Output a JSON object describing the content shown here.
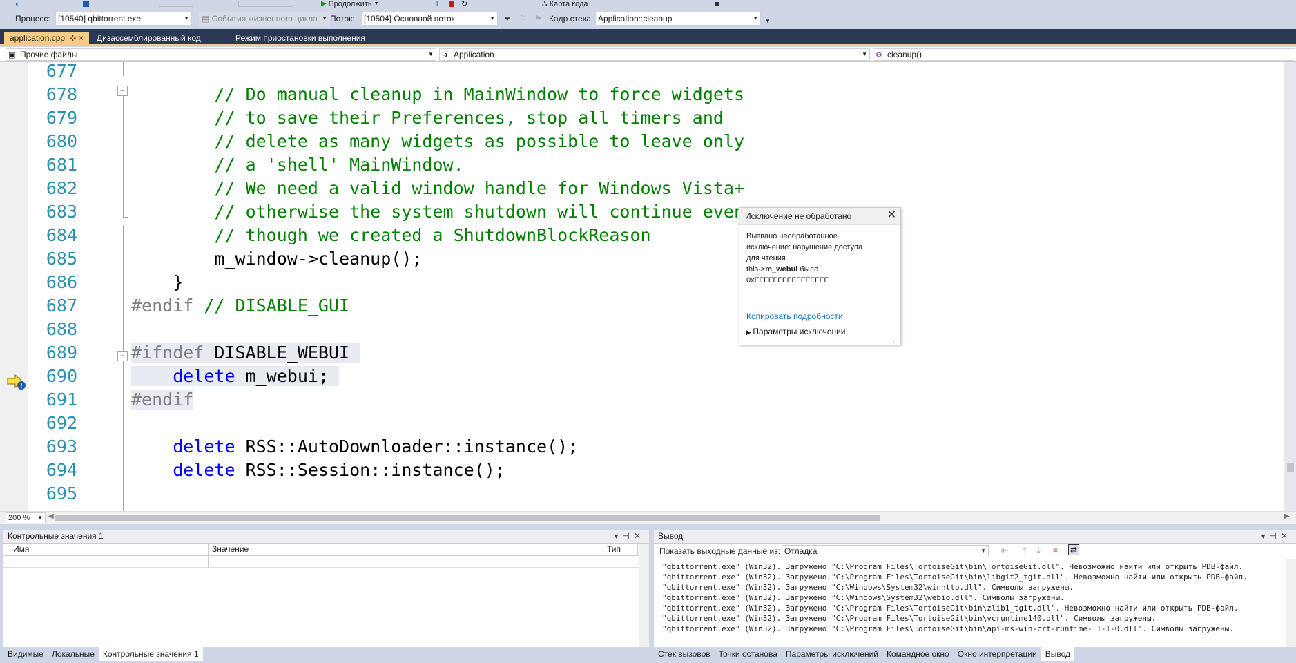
{
  "toolbar_top": {
    "continue_label": "Продолжить",
    "codemap_label": "Карта кода"
  },
  "debug_location": {
    "process_label": "Процесс:",
    "process_value": "[10540] qbittorrent.exe",
    "lifecycle_label": "События жизненного цикла",
    "thread_label": "Поток:",
    "thread_value": "[10504] Основной поток",
    "stackframe_label": "Кадр стека:",
    "stackframe_value": "Application::cleanup"
  },
  "tabs": [
    {
      "label": "application.cpp",
      "pin": "⊹ ×",
      "active": true
    },
    {
      "label": "Дизассемблированный код",
      "active": false
    },
    {
      "label": "Режим приостановки выполнения",
      "active": false
    }
  ],
  "navbar": {
    "project": "Прочие файлы",
    "scope": "Application",
    "member": "cleanup()"
  },
  "editor": {
    "lines": [
      {
        "num": "677",
        "tokens": []
      },
      {
        "num": "678",
        "tokens": [
          {
            "t": "        // Do manual cleanup in MainWindow to force widgets",
            "c": "cmt"
          }
        ]
      },
      {
        "num": "679",
        "tokens": [
          {
            "t": "        // to save their Preferences, stop all timers and",
            "c": "cmt"
          }
        ]
      },
      {
        "num": "680",
        "tokens": [
          {
            "t": "        // delete as many widgets as possible to leave only",
            "c": "cmt"
          }
        ]
      },
      {
        "num": "681",
        "tokens": [
          {
            "t": "        // a 'shell' MainWindow.",
            "c": "cmt"
          }
        ]
      },
      {
        "num": "682",
        "tokens": [
          {
            "t": "        // We need a valid window handle for Windows Vista+",
            "c": "cmt"
          }
        ]
      },
      {
        "num": "683",
        "tokens": [
          {
            "t": "        // otherwise the system shutdown will continue even",
            "c": "cmt"
          }
        ]
      },
      {
        "num": "684",
        "tokens": [
          {
            "t": "        // though we created a ShutdownBlockReason",
            "c": "cmt"
          }
        ]
      },
      {
        "num": "685",
        "tokens": [
          {
            "t": "        m_window->cleanup();",
            "c": ""
          }
        ]
      },
      {
        "num": "686",
        "tokens": [
          {
            "t": "    }",
            "c": ""
          }
        ]
      },
      {
        "num": "687",
        "tokens": [
          {
            "t": "#endif",
            "c": "pp"
          },
          {
            "t": " // DISABLE_GUI",
            "c": "cmt"
          }
        ]
      },
      {
        "num": "688",
        "tokens": []
      },
      {
        "num": "689",
        "tokens": [
          {
            "t": "#ifndef",
            "c": "pp"
          },
          {
            "t": " DISABLE_WEBUI ",
            "c": ""
          }
        ],
        "hl": true
      },
      {
        "num": "690",
        "tokens": [
          {
            "t": "    ",
            "c": ""
          },
          {
            "t": "delete",
            "c": "kw"
          },
          {
            "t": " m_webui; ",
            "c": ""
          }
        ],
        "hl": true
      },
      {
        "num": "691",
        "tokens": [
          {
            "t": "#endif",
            "c": "pp"
          }
        ],
        "hl": true
      },
      {
        "num": "692",
        "tokens": []
      },
      {
        "num": "693",
        "tokens": [
          {
            "t": "    ",
            "c": ""
          },
          {
            "t": "delete",
            "c": "kw"
          },
          {
            "t": " RSS::AutoDownloader::instance();",
            "c": ""
          }
        ]
      },
      {
        "num": "694",
        "tokens": [
          {
            "t": "    ",
            "c": ""
          },
          {
            "t": "delete",
            "c": "kw"
          },
          {
            "t": " RSS::Session::instance();",
            "c": ""
          }
        ]
      },
      {
        "num": "695",
        "tokens": []
      }
    ],
    "zoom": "200 %"
  },
  "exception": {
    "title": "Исключение не обработано",
    "message_l1": "Вызвано необработанное",
    "message_l2": "исключение: нарушение доступа",
    "message_l3": "для чтения.",
    "message_l4_pre": "this->",
    "message_l4_bold": "m_webui",
    "message_l4_post": " было",
    "message_l5": "0xFFFFFFFFFFFFFFFF.",
    "copy_link": "Копировать подробности",
    "params": "Параметры исключений"
  },
  "watch": {
    "title": "Контрольные значения 1",
    "col_name": "Имя",
    "col_value": "Значение",
    "col_type": "Тип"
  },
  "output": {
    "title": "Вывод",
    "show_label": "Показать выходные данные из:",
    "source": "Отладка",
    "lines": [
      "\"qbittorrent.exe\" (Win32). Загружено \"C:\\Program Files\\TortoiseGit\\bin\\TortoiseGit.dll\". Невозможно найти или открыть PDB-файл.",
      "\"qbittorrent.exe\" (Win32). Загружено \"C:\\Program Files\\TortoiseGit\\bin\\libgit2_tgit.dll\". Невозможно найти или открыть PDB-файл.",
      "\"qbittorrent.exe\" (Win32). Загружено \"C:\\Windows\\System32\\winhttp.dll\". Символы загружены.",
      "\"qbittorrent.exe\" (Win32). Загружено \"C:\\Windows\\System32\\webio.dll\". Символы загружены.",
      "\"qbittorrent.exe\" (Win32). Загружено \"C:\\Program Files\\TortoiseGit\\bin\\zlib1_tgit.dll\". Невозможно найти или открыть PDB-файл.",
      "\"qbittorrent.exe\" (Win32). Загружено \"C:\\Program Files\\TortoiseGit\\bin\\vcruntime140.dll\". Символы загружены.",
      "\"qbittorrent.exe\" (Win32). Загружено \"C:\\Program Files\\TortoiseGit\\bin\\api-ms-win-crt-runtime-l1-1-0.dll\". Символы загружены."
    ]
  },
  "bottom_tabs_left": [
    {
      "label": "Видимые",
      "active": false
    },
    {
      "label": "Локальные",
      "active": false
    },
    {
      "label": "Контрольные значения 1",
      "active": true
    }
  ],
  "bottom_tabs_right": [
    {
      "label": "Стек вызовов",
      "active": false
    },
    {
      "label": "Точки останова",
      "active": false
    },
    {
      "label": "Параметры исключений",
      "active": false
    },
    {
      "label": "Командное окно",
      "active": false
    },
    {
      "label": "Окно интерпретации",
      "active": false
    },
    {
      "label": "Вывод",
      "active": true
    }
  ],
  "colors": {
    "tab_active": "#f5cc84",
    "tabbar_bg": "#293955",
    "comment": "#008000",
    "keyword": "#0000ff",
    "line_number": "#2b91af"
  }
}
